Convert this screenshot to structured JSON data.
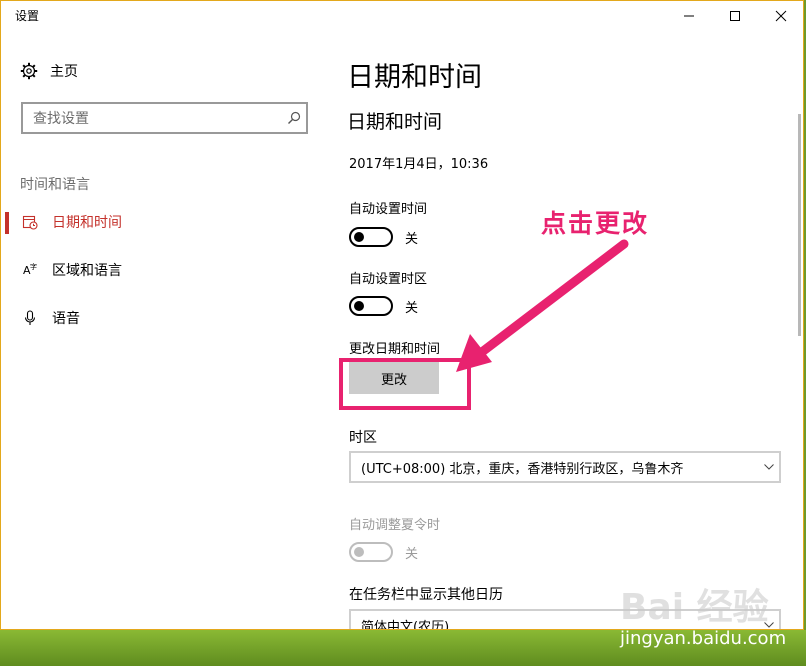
{
  "window": {
    "title": "设置"
  },
  "sidebar": {
    "home_label": "主页",
    "search_placeholder": "查找设置",
    "section_heading": "时间和语言",
    "items": [
      {
        "label": "日期和时间",
        "icon": "calendar-clock-icon",
        "active": true
      },
      {
        "label": "区域和语言",
        "icon": "region-language-icon",
        "active": false
      },
      {
        "label": "语音",
        "icon": "microphone-icon",
        "active": false
      }
    ]
  },
  "main": {
    "page_title": "日期和时间",
    "section_title": "日期和时间",
    "current_datetime": "2017年1月4日，10:36",
    "auto_time": {
      "label": "自动设置时间",
      "state": "关"
    },
    "auto_timezone": {
      "label": "自动设置时区",
      "state": "关"
    },
    "change_datetime": {
      "label": "更改日期和时间",
      "button": "更改"
    },
    "timezone": {
      "label": "时区",
      "value": "(UTC+08:00) 北京，重庆，香港特别行政区，乌鲁木齐"
    },
    "dst": {
      "label": "自动调整夏令时",
      "state": "关"
    },
    "extra_calendar": {
      "label": "在任务栏中显示其他日历",
      "value": "简体中文(农历)"
    }
  },
  "annotation": {
    "text": "点击更改",
    "color": "#e8226f"
  },
  "watermark": {
    "brand": "Bai 经验",
    "url": "jingyan.baidu.com"
  },
  "colors": {
    "accent": "#c4312b",
    "window_border": "#e3a81c"
  }
}
